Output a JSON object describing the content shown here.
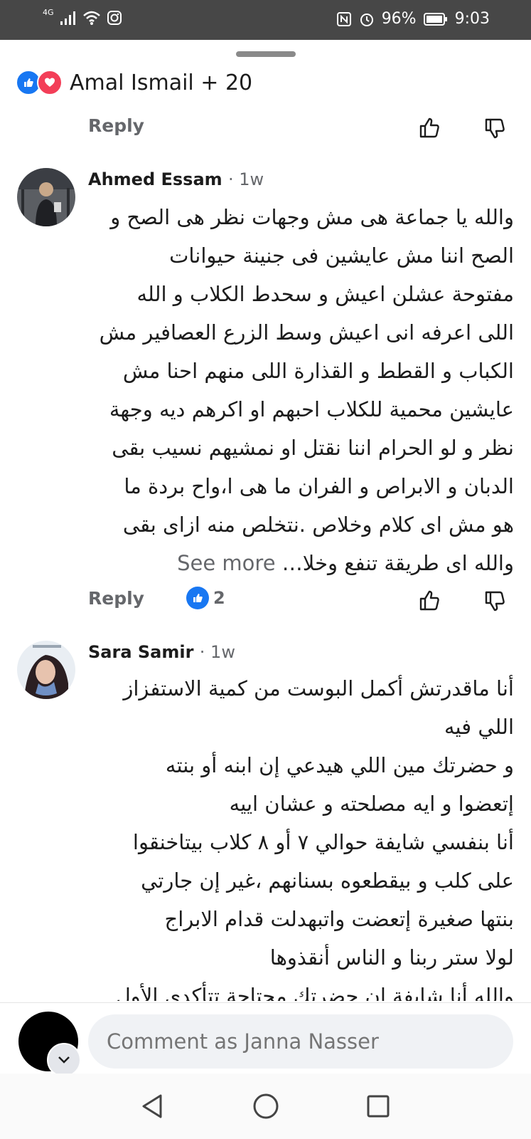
{
  "status_bar": {
    "network_label": "4G",
    "battery": "96%",
    "time": "9:03"
  },
  "reactions": {
    "icons": [
      "like-icon",
      "love-icon"
    ],
    "summary": "Amal Ismail + 20"
  },
  "first_comment_actions": {
    "reply_label": "Reply"
  },
  "comments": [
    {
      "author": "Ahmed Essam",
      "time": "1w",
      "lines": [
        "والله يا جماعة هى مش وجهات نظر هى الصح و",
        "الصح اننا مش عايشين فى جنينة حيوانات",
        "مفتوحة عشلن اعيش و سحدط الكلاب و الله",
        "اللى اعرفه انى اعيش وسط الزرع العصافير مش",
        "الكباب و القطط و القذارة اللى منهم احنا مش",
        "عايشين محمية للكلاب احبهم او اكرهم ديه وجهة",
        "نظر و لو الحرام اننا نقتل او نمشيهم نسيب بقى",
        "الدبان و الابراص و الفران ما هى ا،واح بردة ما",
        "هو مش اى كلام وخلاص .نتخلص منه ازاى بقى",
        "والله اى طريقة تنفع وخلا…"
      ],
      "see_more": "See more",
      "reply_label": "Reply",
      "like_count": "2"
    },
    {
      "author": "Sara Samir",
      "time": "1w",
      "lines": [
        "أنا ماقدرتش أكمل البوست من كمية الاستفزاز",
        "اللي فيه",
        "و حضرتك مين اللي هيدعي إن ابنه أو بنته",
        "إتعضوا و ايه مصلحته و عشان اييه",
        "أنا بنفسي شايفة حوالي ٧ أو ٨ كلاب بيتاخنقوا",
        "على كلب و بيقطعوه بسنانهم ،غير إن جارتي",
        "بنتها صغيرة إتعضت واتبهدلت قدام الابراج",
        "لولا ستر ربنا و الناس أنقذوها",
        "والله أنا شايفة إن حضرتك محتاجة تتأكدي الأول"
      ]
    }
  ],
  "composer": {
    "placeholder": "Comment as Janna Nasser"
  },
  "colors": {
    "accent": "#1877f2",
    "love": "#f33e58",
    "secondary_text": "#65676b",
    "status_bar": "#474747"
  }
}
